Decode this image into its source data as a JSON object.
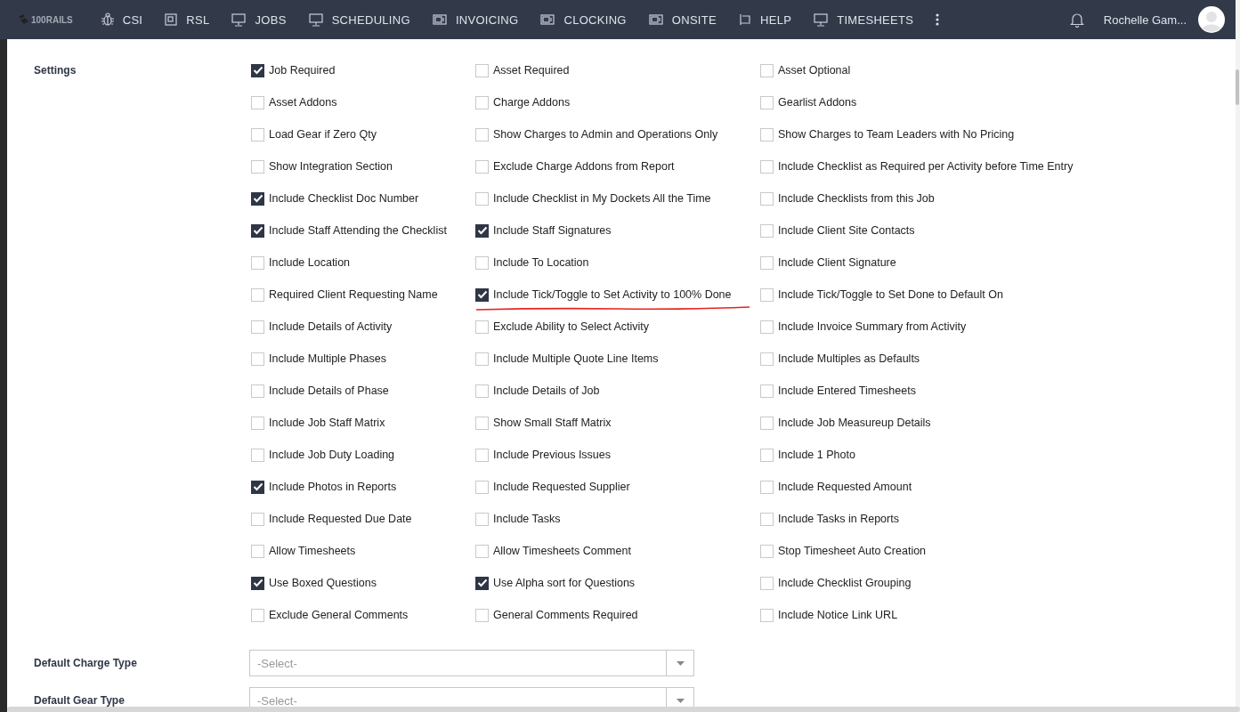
{
  "nav": {
    "logo": "100RAILS",
    "items": [
      {
        "label": "CSI",
        "kind": "bug"
      },
      {
        "label": "RSL",
        "kind": "squares"
      },
      {
        "label": "JOBS",
        "kind": "monitor"
      },
      {
        "label": "SCHEDULING",
        "kind": "monitor"
      },
      {
        "label": "INVOICING",
        "kind": "device"
      },
      {
        "label": "CLOCKING",
        "kind": "device"
      },
      {
        "label": "ONSITE",
        "kind": "device"
      },
      {
        "label": "HELP",
        "kind": "desk"
      },
      {
        "label": "TIMESHEETS",
        "kind": "monitor"
      }
    ],
    "user": "Rochelle Gam..."
  },
  "settings": {
    "label": "Settings",
    "options": [
      {
        "label": "Job Required",
        "checked": true,
        "underlined": false
      },
      {
        "label": "Asset Required",
        "checked": false,
        "underlined": false
      },
      {
        "label": "Asset Optional",
        "checked": false,
        "underlined": false
      },
      {
        "label": "Asset Addons",
        "checked": false,
        "underlined": false
      },
      {
        "label": "Charge Addons",
        "checked": false,
        "underlined": false
      },
      {
        "label": "Gearlist Addons",
        "checked": false,
        "underlined": false
      },
      {
        "label": "Load Gear if Zero Qty",
        "checked": false,
        "underlined": false
      },
      {
        "label": "Show Charges to Admin and Operations Only",
        "checked": false,
        "underlined": false
      },
      {
        "label": "Show Charges to Team Leaders with No Pricing",
        "checked": false,
        "underlined": false
      },
      {
        "label": "Show Integration Section",
        "checked": false,
        "underlined": false
      },
      {
        "label": "Exclude Charge Addons from Report",
        "checked": false,
        "underlined": false
      },
      {
        "label": "Include Checklist as Required per Activity before Time Entry",
        "checked": false,
        "underlined": false
      },
      {
        "label": "Include Checklist Doc Number",
        "checked": true,
        "underlined": false
      },
      {
        "label": "Include Checklist in My Dockets All the Time",
        "checked": false,
        "underlined": false
      },
      {
        "label": "Include Checklists from this Job",
        "checked": false,
        "underlined": false
      },
      {
        "label": "Include Staff Attending the Checklist",
        "checked": true,
        "underlined": false
      },
      {
        "label": "Include Staff Signatures",
        "checked": true,
        "underlined": false
      },
      {
        "label": "Include Client Site Contacts",
        "checked": false,
        "underlined": false
      },
      {
        "label": "Include Location",
        "checked": false,
        "underlined": false
      },
      {
        "label": "Include To Location",
        "checked": false,
        "underlined": false
      },
      {
        "label": "Include Client Signature",
        "checked": false,
        "underlined": false
      },
      {
        "label": "Required Client Requesting Name",
        "checked": false,
        "underlined": false
      },
      {
        "label": "Include Tick/Toggle to Set Activity to 100% Done",
        "checked": true,
        "underlined": true
      },
      {
        "label": "Include Tick/Toggle to Set Done to Default On",
        "checked": false,
        "underlined": false
      },
      {
        "label": "Include Details of Activity",
        "checked": false,
        "underlined": false
      },
      {
        "label": "Exclude Ability to Select Activity",
        "checked": false,
        "underlined": false
      },
      {
        "label": "Include Invoice Summary from Activity",
        "checked": false,
        "underlined": false
      },
      {
        "label": "Include Multiple Phases",
        "checked": false,
        "underlined": false
      },
      {
        "label": "Include Multiple Quote Line Items",
        "checked": false,
        "underlined": false
      },
      {
        "label": "Include Multiples as Defaults",
        "checked": false,
        "underlined": false
      },
      {
        "label": "Include Details of Phase",
        "checked": false,
        "underlined": false
      },
      {
        "label": "Include Details of Job",
        "checked": false,
        "underlined": false
      },
      {
        "label": "Include Entered Timesheets",
        "checked": false,
        "underlined": false
      },
      {
        "label": "Include Job Staff Matrix",
        "checked": false,
        "underlined": false
      },
      {
        "label": "Show Small Staff Matrix",
        "checked": false,
        "underlined": false
      },
      {
        "label": "Include Job Measureup Details",
        "checked": false,
        "underlined": false
      },
      {
        "label": "Include Job Duty Loading",
        "checked": false,
        "underlined": false
      },
      {
        "label": "Include Previous Issues",
        "checked": false,
        "underlined": false
      },
      {
        "label": "Include 1 Photo",
        "checked": false,
        "underlined": false
      },
      {
        "label": "Include Photos in Reports",
        "checked": true,
        "underlined": false
      },
      {
        "label": "Include Requested Supplier",
        "checked": false,
        "underlined": false
      },
      {
        "label": "Include Requested Amount",
        "checked": false,
        "underlined": false
      },
      {
        "label": "Include Requested Due Date",
        "checked": false,
        "underlined": false
      },
      {
        "label": "Include Tasks",
        "checked": false,
        "underlined": false
      },
      {
        "label": "Include Tasks in Reports",
        "checked": false,
        "underlined": false
      },
      {
        "label": "Allow Timesheets",
        "checked": false,
        "underlined": false
      },
      {
        "label": "Allow Timesheets Comment",
        "checked": false,
        "underlined": false
      },
      {
        "label": "Stop Timesheet Auto Creation",
        "checked": false,
        "underlined": false
      },
      {
        "label": "Use Boxed Questions",
        "checked": true,
        "underlined": false
      },
      {
        "label": "Use Alpha sort for Questions",
        "checked": true,
        "underlined": false
      },
      {
        "label": "Include Checklist Grouping",
        "checked": false,
        "underlined": false
      },
      {
        "label": "Exclude General Comments",
        "checked": false,
        "underlined": false
      },
      {
        "label": "General Comments Required",
        "checked": false,
        "underlined": false
      },
      {
        "label": "Include Notice Link URL",
        "checked": false,
        "underlined": false
      }
    ]
  },
  "selects": [
    {
      "label": "Default Charge Type",
      "placeholder": "-Select-"
    },
    {
      "label": "Default Gear Type",
      "placeholder": "-Select-"
    }
  ]
}
